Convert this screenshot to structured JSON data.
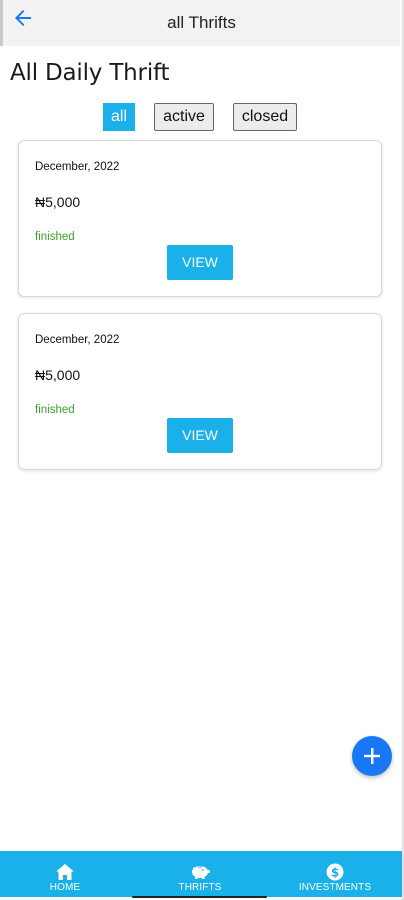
{
  "app_bar": {
    "title": "all Thrifts",
    "back_icon": "arrow-left-icon"
  },
  "page": {
    "title": "All Daily Thrift"
  },
  "filters": [
    {
      "label": "all",
      "selected": true
    },
    {
      "label": "active",
      "selected": false
    },
    {
      "label": "closed",
      "selected": false
    }
  ],
  "cards": [
    {
      "date": "December, 2022",
      "amount": "₦5,000",
      "status": "finished",
      "button_label": "VIEW"
    },
    {
      "date": "December, 2022",
      "amount": "₦5,000",
      "status": "finished",
      "button_label": "VIEW"
    }
  ],
  "fab": {
    "icon": "plus-icon"
  },
  "bottom_nav": [
    {
      "label": "HOME",
      "icon": "home-icon"
    },
    {
      "label": "THRIFTS",
      "icon": "piggy-bank-icon"
    },
    {
      "label": "INVESTMENTS",
      "icon": "dollar-coin-icon"
    }
  ],
  "colors": {
    "accent": "#1ab0ea",
    "fab": "#1877f2",
    "status_finished": "#3ea02a"
  }
}
